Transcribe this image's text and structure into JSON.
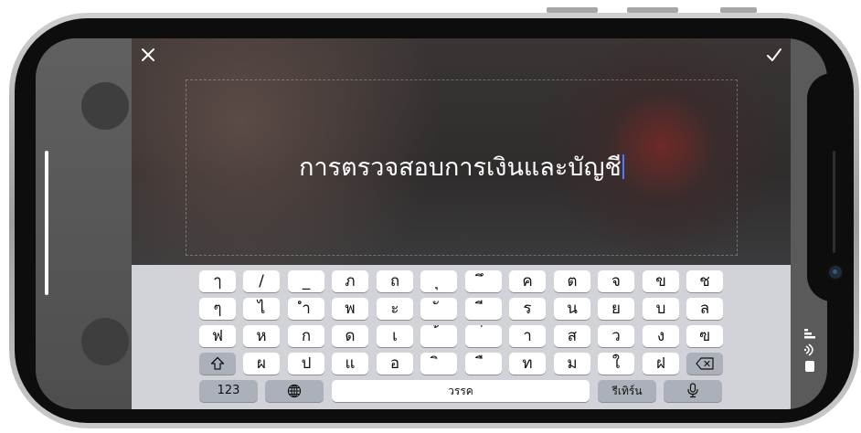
{
  "editor": {
    "close_icon": "close-icon",
    "done_icon": "checkmark-icon",
    "text": "การตรวจสอบการเงินและบัญชี"
  },
  "keyboard": {
    "row1": [
      "ๅ",
      "/",
      "_",
      "ภ",
      "ถ",
      "ุ",
      "ึ",
      "ค",
      "ต",
      "จ",
      "ข",
      "ช"
    ],
    "row2": [
      "ๆ",
      "ไ",
      "ำ",
      "พ",
      "ะ",
      "ั",
      "ี",
      "ร",
      "น",
      "ย",
      "บ",
      "ล"
    ],
    "row3": [
      "ฟ",
      "ห",
      "ก",
      "ด",
      "เ",
      "้",
      "่",
      "า",
      "ส",
      "ว",
      "ง",
      "ฃ"
    ],
    "row4": [
      "ผ",
      "ป",
      "แ",
      "อ",
      "ิ",
      "ื",
      "ท",
      "ม",
      "ใ",
      "ฝ"
    ],
    "numbers_label": "123",
    "space_label": "วรรค",
    "return_label": "รีเทิร์น",
    "shift_icon": "shift-icon",
    "delete_icon": "delete-icon",
    "globe_icon": "globe-icon",
    "mic_icon": "microphone-icon"
  },
  "status_icons": [
    "signal-icon",
    "wifi-icon",
    "battery-icon"
  ]
}
